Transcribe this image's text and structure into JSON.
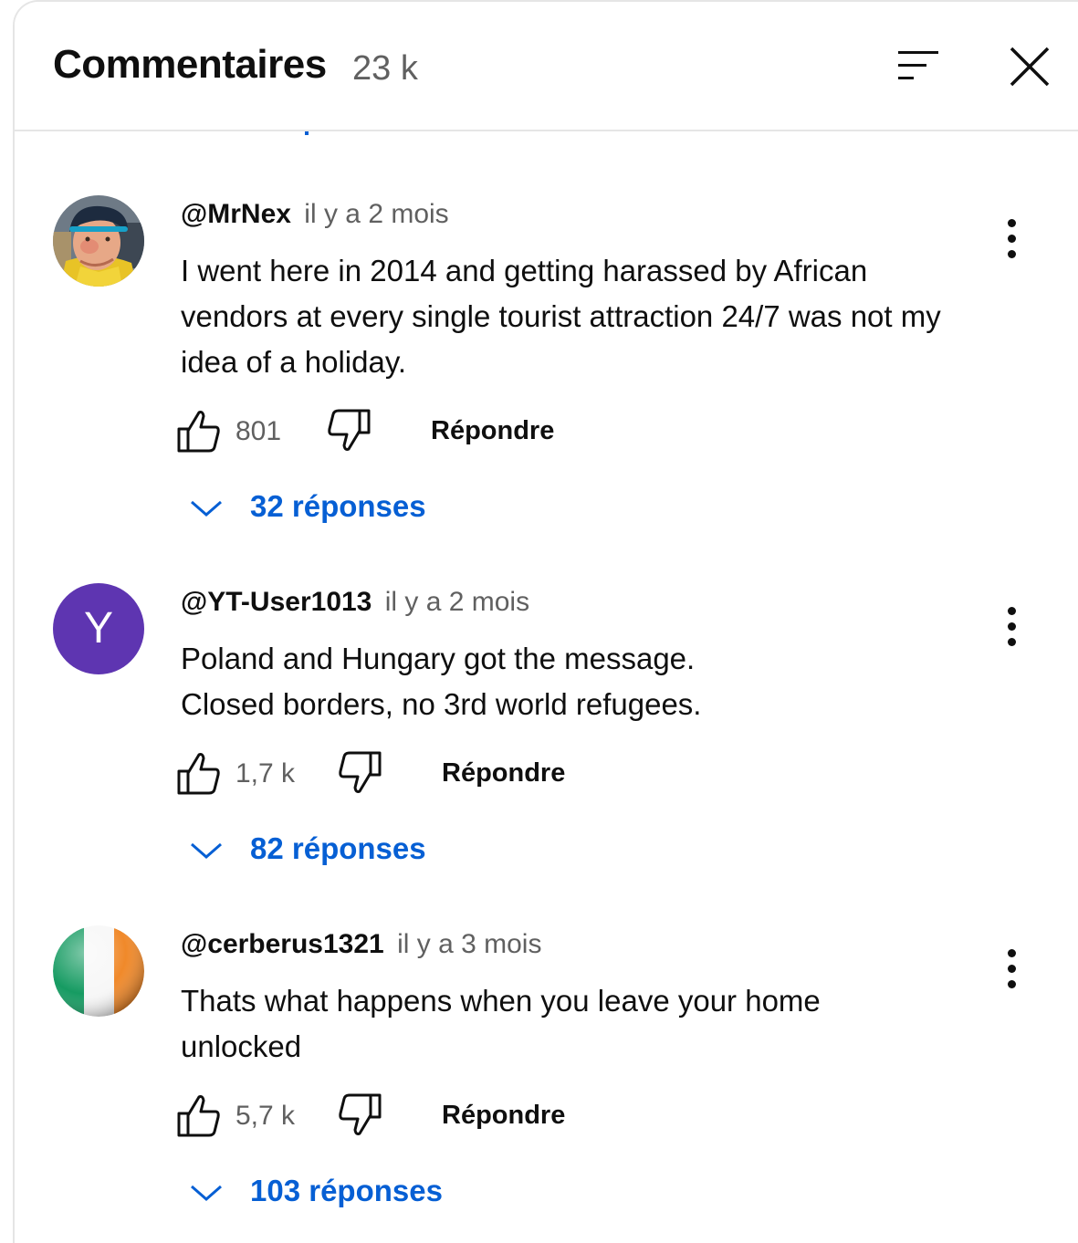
{
  "header": {
    "title": "Commentaires",
    "count": "23 k"
  },
  "comments": [
    {
      "author": "@MrNex",
      "time": "il y a 2 mois",
      "text": "I went here in 2014 and getting harassed by African vendors at every single tourist attraction 24/7 was not my idea of a holiday.",
      "likes": "801",
      "reply_label": "Répondre",
      "replies_label": "32 réponses",
      "avatar": "photo"
    },
    {
      "author": "@YT-User1013",
      "time": "il y a 2 mois",
      "text": "Poland and Hungary got the message.\nClosed borders, no 3rd world refugees.",
      "likes": "1,7 k",
      "reply_label": "Répondre",
      "replies_label": "82 réponses",
      "avatar_letter": "Y",
      "avatar_color": "#5e35b1"
    },
    {
      "author": "@cerberus1321",
      "time": "il y a 3 mois",
      "text": "Thats what happens when you leave your home unlocked",
      "likes": "5,7 k",
      "reply_label": "Répondre",
      "replies_label": "103 réponses",
      "avatar": "irish-flag"
    }
  ],
  "colors": {
    "link": "#065fd4",
    "secondary_text": "#606060",
    "divider": "#e5e5e5"
  }
}
